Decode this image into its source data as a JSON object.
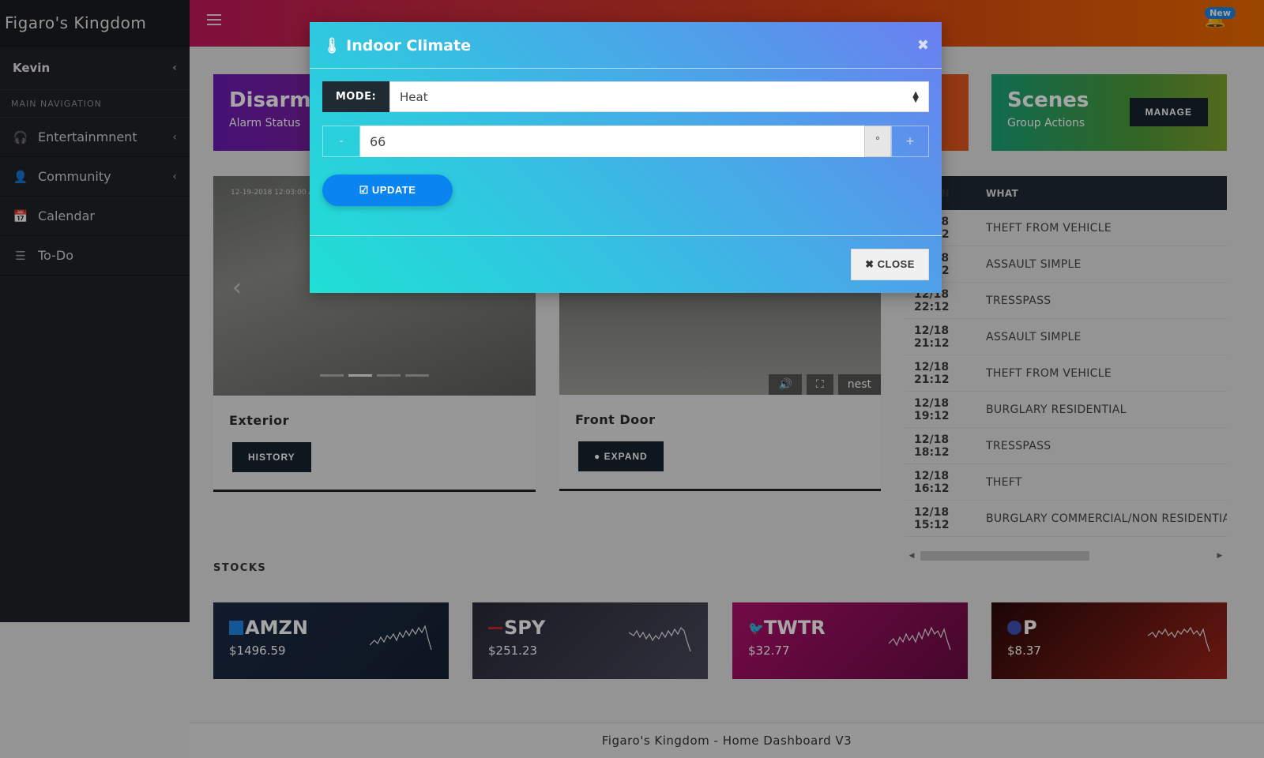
{
  "sidebar": {
    "brand": "Figaro's Kingdom",
    "user": "Kevin",
    "nav_header": "MAIN NAVIGATION",
    "items": [
      {
        "label": "Entertainmnent",
        "icon": "headphones-icon",
        "glyph": "🎧"
      },
      {
        "label": "Community",
        "icon": "users-icon",
        "glyph": "👤"
      },
      {
        "label": "Calendar",
        "icon": "calendar-icon",
        "glyph": "📅"
      },
      {
        "label": "To-Do",
        "icon": "list-icon",
        "glyph": "☰"
      }
    ]
  },
  "topbar": {
    "badge": "New"
  },
  "alarm": {
    "title": "Disarmed",
    "subtitle": "Alarm Status"
  },
  "scenes": {
    "title": "Scenes",
    "subtitle": "Group Actions",
    "button": "MANAGE"
  },
  "cameras": {
    "exterior": {
      "title": "Exterior",
      "button": "HISTORY",
      "timestamp": "12-19-2018 12:03:00 AM"
    },
    "front": {
      "title": "Front Door",
      "button": "EXPAND",
      "brand": "nest"
    }
  },
  "crime": {
    "headers": {
      "when": "WHEN",
      "what": "WHAT"
    },
    "rows": [
      {
        "when": "12/18 23:12",
        "what": "THEFT FROM VEHICLE"
      },
      {
        "when": "12/18 22:12",
        "what": "ASSAULT SIMPLE"
      },
      {
        "when": "12/18 22:12",
        "what": "TRESSPASS"
      },
      {
        "when": "12/18 21:12",
        "what": "ASSAULT SIMPLE"
      },
      {
        "when": "12/18 21:12",
        "what": "THEFT FROM VEHICLE"
      },
      {
        "when": "12/18 19:12",
        "what": "BURGLARY RESIDENTIAL"
      },
      {
        "when": "12/18 18:12",
        "what": "TRESSPASS"
      },
      {
        "when": "12/18 16:12",
        "what": "THEFT"
      },
      {
        "when": "12/18 15:12",
        "what": "BURGLARY COMMERCIAL/NON RESIDENTIAL"
      }
    ]
  },
  "stocks": {
    "title": "STOCKS",
    "items": [
      {
        "symbol": "AMZN",
        "price": "$1496.59",
        "logo_color": "#1e88e5"
      },
      {
        "symbol": "SPY",
        "price": "$251.23",
        "logo_color": "#c62828"
      },
      {
        "symbol": "TWTR",
        "price": "$32.77",
        "logo_color": "#1da1f2"
      },
      {
        "symbol": "P",
        "price": "$8.37",
        "logo_color": "#3f51b5"
      }
    ]
  },
  "footer": "Figaro's Kingdom - Home Dashboard V3",
  "modal": {
    "title": "Indoor Climate",
    "mode_label": "MODE:",
    "mode_value": "Heat",
    "minus": "-",
    "temperature": "66",
    "unit": "°",
    "plus": "+",
    "update_label": "UPDATE",
    "close_label": "CLOSE"
  }
}
